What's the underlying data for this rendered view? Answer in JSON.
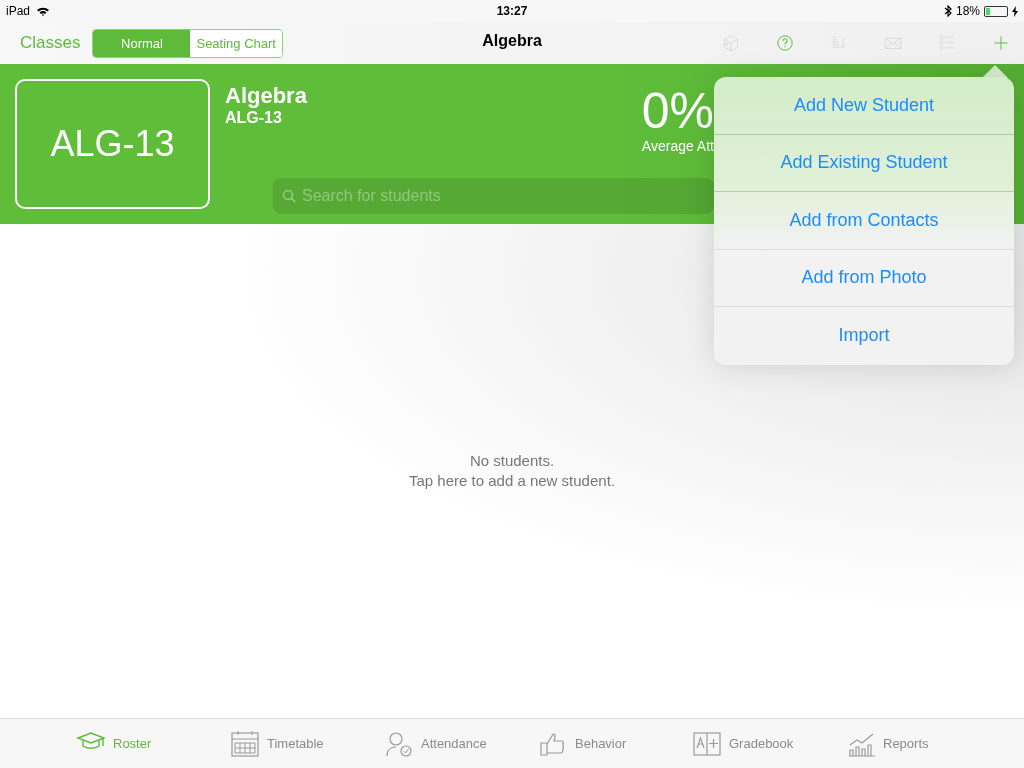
{
  "status_bar": {
    "device": "iPad",
    "time": "13:27",
    "battery": "18%"
  },
  "nav_bar": {
    "back": "Classes",
    "segments": [
      {
        "label": "Normal",
        "selected": true
      },
      {
        "label": "Seating Chart",
        "selected": false
      }
    ],
    "title": "Algebra",
    "tools": [
      {
        "kind": "dice",
        "disabled": true
      },
      {
        "kind": "help",
        "disabled": false
      },
      {
        "kind": "sort",
        "disabled": true
      },
      {
        "kind": "mail",
        "disabled": true
      },
      {
        "kind": "checklist",
        "disabled": true
      },
      {
        "kind": "add",
        "disabled": false
      }
    ]
  },
  "class_header": {
    "code_badge": "ALG-13",
    "name": "Algebra",
    "code": "ALG-13",
    "stat_value": "0%",
    "stat_label": "Average Att",
    "search": {
      "placeholder": "Search for students"
    }
  },
  "empty_state": {
    "title": "No students.",
    "hint": "Tap here to add a new student."
  },
  "add_menu": {
    "items": [
      "Add New Student",
      "Add Existing Student",
      "Add from Contacts",
      "Add from Photo",
      "Import"
    ]
  },
  "tab_bar": [
    {
      "label": "Roster",
      "kind": "roster",
      "selected": true
    },
    {
      "label": "Timetable",
      "kind": "timetable",
      "selected": false
    },
    {
      "label": "Attendance",
      "kind": "attendance",
      "selected": false
    },
    {
      "label": "Behavior",
      "kind": "behavior",
      "selected": false
    },
    {
      "label": "Gradebook",
      "kind": "gradebook",
      "selected": false
    },
    {
      "label": "Reports",
      "kind": "reports",
      "selected": false
    }
  ]
}
